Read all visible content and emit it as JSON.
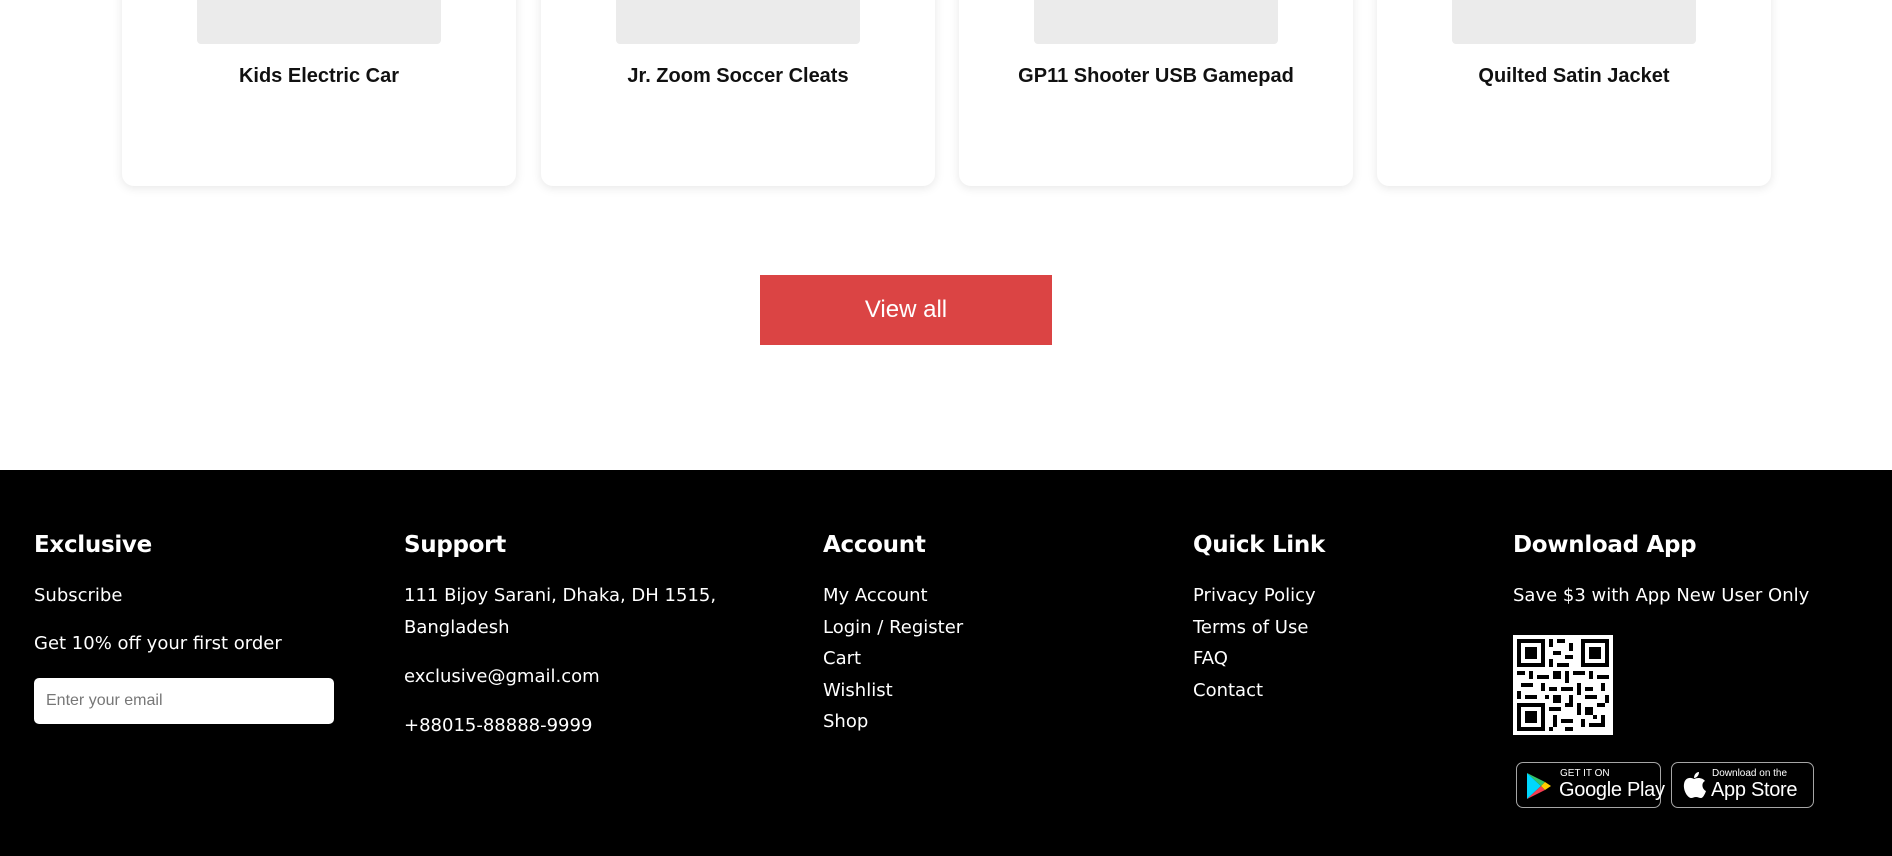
{
  "products": [
    {
      "title": "Kids Electric Car"
    },
    {
      "title": "Jr. Zoom Soccer Cleats"
    },
    {
      "title": "GP11 Shooter USB Gamepad"
    },
    {
      "title": "Quilted Satin Jacket"
    }
  ],
  "view_all_label": "View all",
  "footer": {
    "exclusive": {
      "heading": "Exclusive",
      "subscribe": "Subscribe",
      "offer": "Get 10% off your first order",
      "email_placeholder": "Enter your email"
    },
    "support": {
      "heading": "Support",
      "address_line1": "111 Bijoy Sarani, Dhaka, DH 1515,",
      "address_line2": "Bangladesh",
      "email": "exclusive@gmail.com",
      "phone": "+88015-88888-9999"
    },
    "account": {
      "heading": "Account",
      "links": [
        "My Account",
        "Login / Register",
        "Cart",
        "Wishlist",
        "Shop"
      ]
    },
    "quick_link": {
      "heading": "Quick Link",
      "links": [
        "Privacy Policy",
        "Terms of Use",
        "FAQ",
        "Contact"
      ]
    },
    "download": {
      "heading": "Download App",
      "promo": "Save $3 with App New User Only",
      "google_small": "GET IT ON",
      "google_big": "Google Play",
      "apple_small": "Download on the",
      "apple_big": "App Store"
    }
  },
  "colors": {
    "accent": "#DB4444",
    "footer_bg": "#000000",
    "thumb_bg": "#EBEBEB"
  },
  "icons": [
    "qr-code-icon",
    "google-play-icon",
    "apple-icon"
  ]
}
